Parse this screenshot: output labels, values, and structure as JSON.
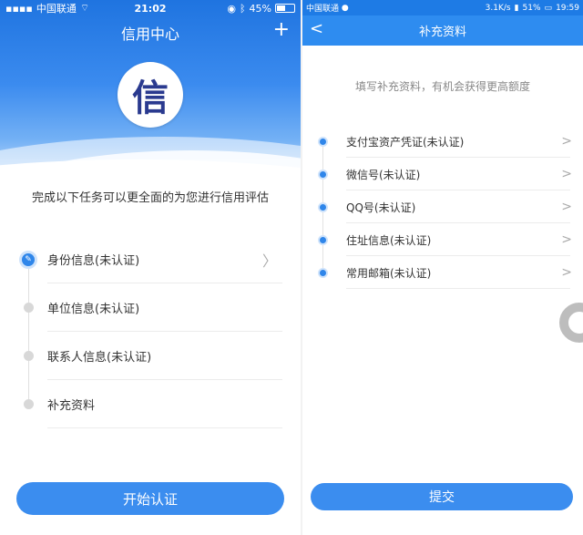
{
  "left": {
    "status_bar": {
      "carrier": "中国联通",
      "time": "21:02",
      "battery": "45%"
    },
    "title": "信用中心",
    "plus_glyph": "+",
    "logo_text": "信",
    "subtitle": "完成以下任务可以更全面的为您进行信用评估",
    "tasks": [
      {
        "label": "身份信息(未认证)"
      },
      {
        "label": "单位信息(未认证)"
      },
      {
        "label": "联系人信息(未认证)"
      },
      {
        "label": "补充资料"
      }
    ],
    "start_button": "开始认证",
    "edit_glyph": "✎"
  },
  "right": {
    "status_bar": {
      "carrier": "中国联通",
      "speed": "3.1K/s",
      "battery": "51%",
      "time": "19:59"
    },
    "title": "补充资料",
    "back_glyph": "<",
    "hint": "填写补充资料，有机会获得更高额度",
    "items": [
      {
        "label": "支付宝资产凭证(未认证)"
      },
      {
        "label": "微信号(未认证)"
      },
      {
        "label": "QQ号(未认证)"
      },
      {
        "label": "住址信息(未认证)"
      },
      {
        "label": "常用邮箱(未认证)"
      }
    ],
    "submit_button": "提交",
    "chevron_glyph": ">"
  }
}
